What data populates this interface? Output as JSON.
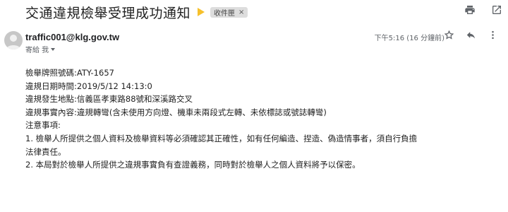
{
  "email": {
    "subject": "交通違規檢舉受理成功通知",
    "label": "收件匣",
    "label_remove": "×",
    "sender": "traffic001@klg.gov.tw",
    "to_line": "寄給 我",
    "datetime": "下午5:16 (16 分鐘前)"
  },
  "body": {
    "plate": "檢舉牌照號碼:ATY-1657",
    "datetime": "違規日期時間:2019/5/12 14:13:0",
    "location": "違規發生地點:信義區孝東路88號和深溪路交叉",
    "content": "違規事實內容:違規轉彎(含未使用方向燈、機車未兩段式左轉、未依標誌或號誌轉彎)",
    "notes_title": "注意事項:",
    "note1": "1. 檢舉人所提供之個人資料及檢舉資料等必須確認其正確性，如有任何編造、捏造、偽造情事者，須自行負擔法律責任。",
    "note2": "2. 本局對於檢舉人所提供之違規事實負有查證義務，同時對於檢舉人之個人資料將予以保密。"
  },
  "icons": {
    "important": "importance-marker-icon",
    "print": "print-icon",
    "new_window": "open-in-new-window-icon",
    "star": "star-icon",
    "reply": "reply-icon",
    "more": "more-vertical-icon",
    "avatar": "avatar-icon"
  },
  "colors": {
    "important": "#f6c02b",
    "label_bg": "#dddddd",
    "secondary_text": "#5f6368"
  }
}
